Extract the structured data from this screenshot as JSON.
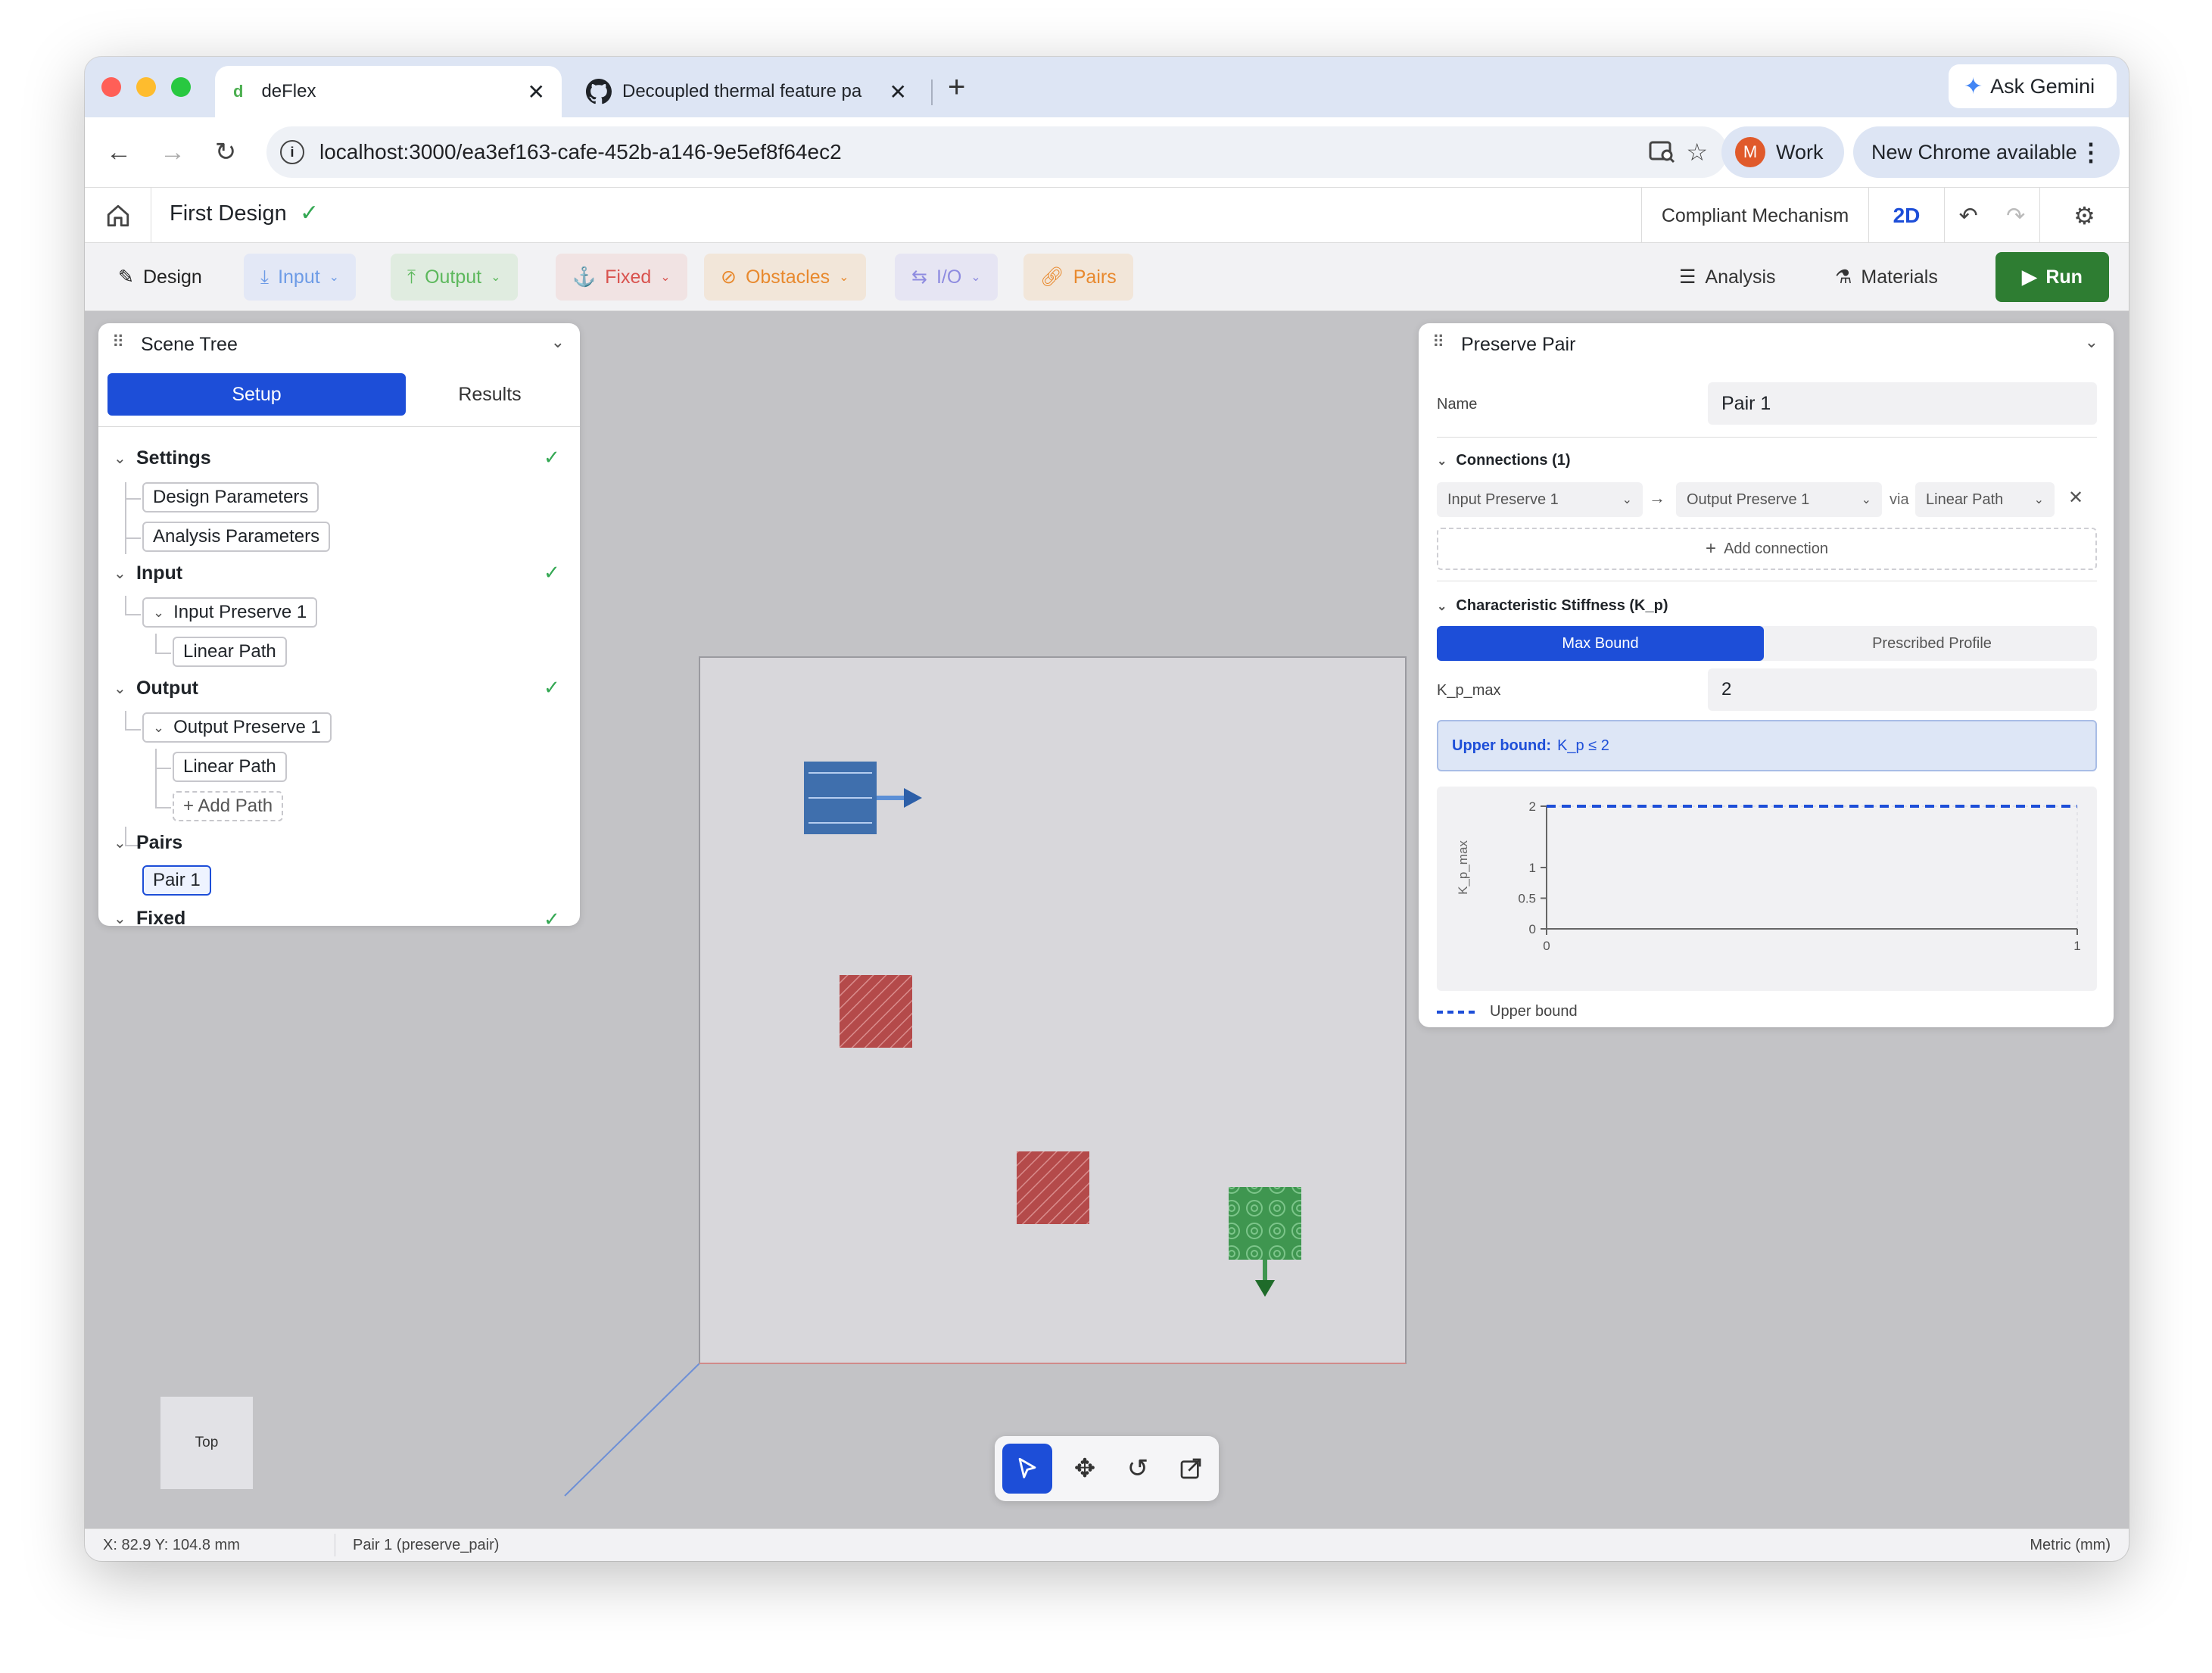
{
  "browser": {
    "tabs": [
      {
        "label": "deFlex",
        "favicon": "d"
      },
      {
        "label": "Decoupled thermal feature pa"
      }
    ],
    "url": "localhost:3000/ea3ef163-cafe-452b-a146-9e5ef8f64ec2",
    "ask_gemini": "Ask Gemini",
    "profile_initial": "M",
    "profile_label": "Work",
    "update_label": "New Chrome available"
  },
  "app": {
    "design_name": "First Design",
    "mode_label": "Compliant Mechanism",
    "view_mode": "2D"
  },
  "toolbar": {
    "design": "Design",
    "input": "Input",
    "output": "Output",
    "fixed": "Fixed",
    "obstacles": "Obstacles",
    "io": "I/O",
    "pairs": "Pairs",
    "analysis": "Analysis",
    "materials": "Materials",
    "run": "Run",
    "colors": {
      "input": "#6d9be6",
      "output": "#5cb85c",
      "fixed": "#d9534f",
      "obstacles": "#e8892e",
      "io": "#8e8be0",
      "pairs": "#e8892e",
      "run": "#2e7d32"
    }
  },
  "scene_tree": {
    "title": "Scene Tree",
    "tabs": {
      "setup": "Setup",
      "results": "Results"
    },
    "settings": {
      "label": "Settings",
      "children": [
        "Design Parameters",
        "Analysis Parameters"
      ]
    },
    "input": {
      "label": "Input",
      "preserve": "Input Preserve 1",
      "path": "Linear Path"
    },
    "output": {
      "label": "Output",
      "preserve": "Output Preserve 1",
      "path": "Linear Path",
      "add_path": "+ Add Path"
    },
    "pairs": {
      "label": "Pairs",
      "item": "Pair 1"
    },
    "fixed": {
      "label": "Fixed"
    }
  },
  "viewport": {
    "view_cube_label": "Top"
  },
  "preserve_pair": {
    "title": "Preserve Pair",
    "name_label": "Name",
    "name_value": "Pair 1",
    "connections_label": "Connections (1)",
    "connection": {
      "from": "Input Preserve 1",
      "to": "Output Preserve 1",
      "via_label": "via",
      "path": "Linear Path"
    },
    "add_connection": "Add connection",
    "stiffness_label": "Characteristic Stiffness (K_p)",
    "tabs": {
      "max_bound": "Max Bound",
      "prescribed": "Prescribed Profile"
    },
    "kp_max_label": "K_p_max",
    "kp_max_value": "2",
    "upper_bound_title": "Upper bound:",
    "upper_bound_value": "K_p ≤ 2",
    "legend_label": "Upper bound"
  },
  "chart_data": {
    "type": "line",
    "ylabel": "K_p_max",
    "xlabel": "",
    "x_ticks": [
      "0",
      "1"
    ],
    "y_ticks": [
      "0",
      "0.5",
      "1",
      "2"
    ],
    "xlim": [
      0,
      1
    ],
    "ylim": [
      0,
      2
    ],
    "series": [
      {
        "name": "Upper bound",
        "x": [
          0,
          1
        ],
        "y": [
          2,
          2
        ],
        "style": "dashed",
        "color": "#1d4ed8"
      }
    ]
  },
  "status": {
    "coords": "X: 82.9 Y: 104.8 mm",
    "selection": "Pair 1 (preserve_pair)",
    "units": "Metric (mm)"
  }
}
